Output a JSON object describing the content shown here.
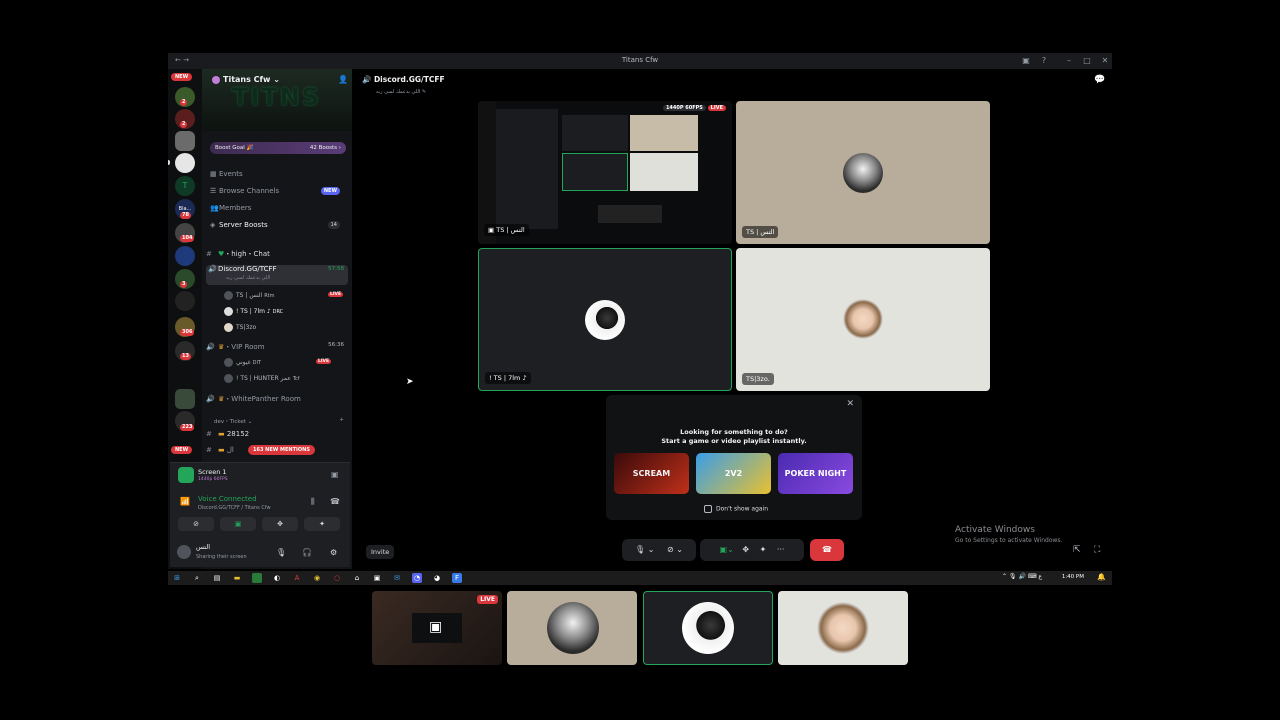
{
  "window": {
    "title": "Titans Cfw",
    "minimize": "–",
    "maximize": "□",
    "close": "✕"
  },
  "server": {
    "name": "Titans Cfw ⌄",
    "banner_text": "TITNS",
    "boost_goal": "Boost Goal 🎉",
    "boost_count": "42 Boosts ›"
  },
  "rail": {
    "new_top": "NEW",
    "new_bottom": "NEW",
    "badges": [
      "2",
      "2",
      "78",
      "104",
      "3",
      "306",
      "13",
      "223"
    ],
    "label_text": "Bla..."
  },
  "nav": {
    "events": "Events",
    "browse": "Browse Channels",
    "browse_tag": "NEW",
    "members": "Members",
    "boosts": "Server Boosts",
    "boosts_count": "14"
  },
  "channels": {
    "high_chat": "・high・Chat",
    "current": "Discord.GG/TCFF",
    "current_timer": "57:58",
    "current_sub": "اللي يدعمك لسي ربه",
    "vip_room": "・VIP Room",
    "vip_timer": "56:36",
    "whitepanther": "・WhitePanther Room",
    "category": "dev・Ticket ⌄",
    "ticket": "28152",
    "last": "ال"
  },
  "voice_users": {
    "u1": "TS | النس",
    "u1_tag": "Rtm",
    "u2": "! TS | 7lm ♪",
    "u2_tag": "DRC",
    "u3": "TS|3zo",
    "u4": "غيوني",
    "u4_tag": "DIT",
    "u5": "! TS | HUNTER عمر",
    "u5_tag": "Tcf",
    "live": "LIVE"
  },
  "mentions_pill": "163 NEW MENTIONS",
  "voice_panel": {
    "screen_title": "Screen 1",
    "screen_sub": "1440p 60FPS",
    "connected": "Voice Connected",
    "channel": "Discord.GG/TCFF / Titans Cfw",
    "user": "التس",
    "status": "Sharing their screen"
  },
  "stage": {
    "title": "Discord.GG/TCFF",
    "subtitle": "اللي يدعمك لسي ربه ✎",
    "stream_badge": "1440P 60FPS",
    "live": "LIVE",
    "tiles": [
      {
        "name": "TS | التس"
      },
      {
        "name": "TS | التس"
      },
      {
        "name": "! TS | 7lm ♪"
      },
      {
        "name": "TS|3zo."
      }
    ]
  },
  "popup": {
    "line1": "Looking for something to do?",
    "line2": "Start a game or video playlist instantly.",
    "games": [
      "SCREAM",
      "2V2",
      "POKER NIGHT"
    ],
    "checkbox": "Don't show again",
    "close": "✕"
  },
  "controls": {
    "invite": "Invite",
    "more": "···"
  },
  "watermark": {
    "line1": "Activate Windows",
    "line2": "Go to Settings to activate Windows."
  },
  "taskbar": {
    "time": "1:40 PM"
  },
  "strip": {
    "live": "LIVE"
  },
  "colors": {
    "accent_green": "#23a55a",
    "danger": "#da373c",
    "blurple": "#5865f2",
    "bg": "#000000"
  }
}
